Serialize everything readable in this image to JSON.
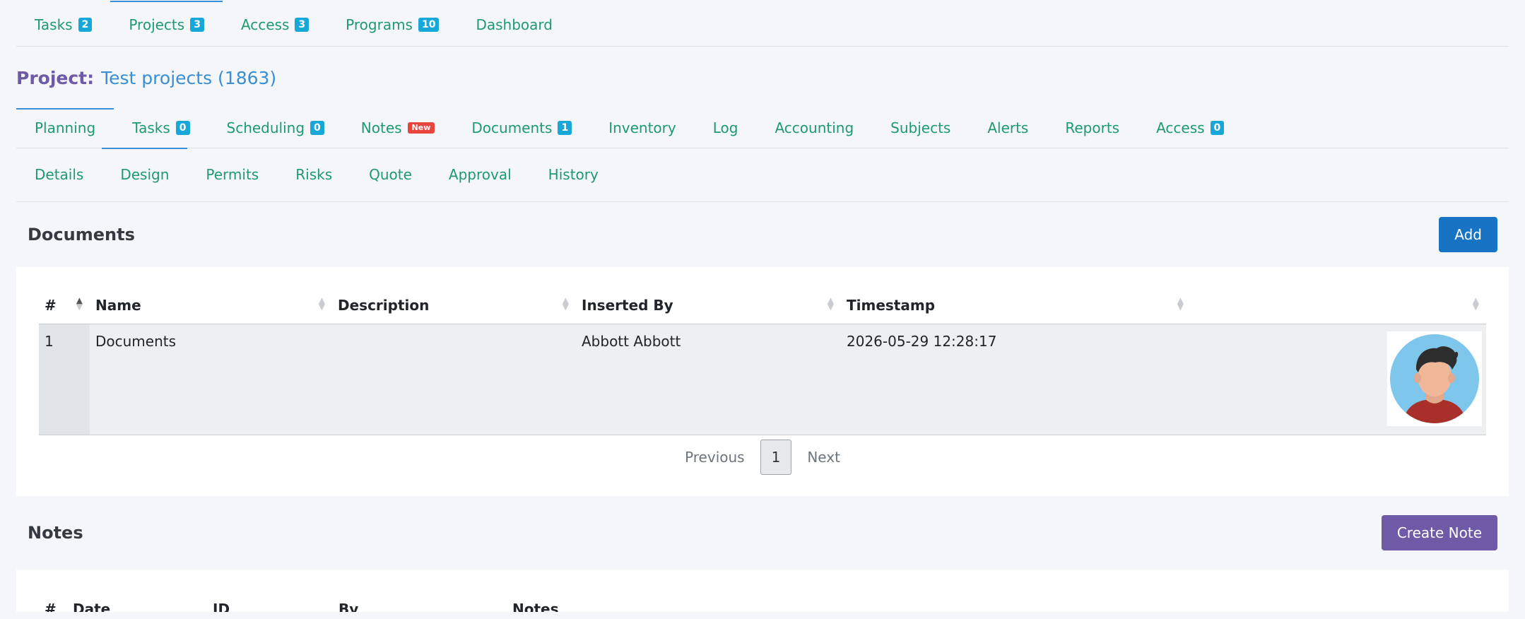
{
  "top_tabs": [
    {
      "label": "Tasks",
      "badge": "2"
    },
    {
      "label": "Projects",
      "badge": "3"
    },
    {
      "label": "Access",
      "badge": "3"
    },
    {
      "label": "Programs",
      "badge": "10"
    },
    {
      "label": "Dashboard"
    }
  ],
  "project": {
    "label": "Project:",
    "value": "Test projects (1863)"
  },
  "project_tabs": [
    {
      "label": "Planning"
    },
    {
      "label": "Tasks",
      "badge": "0"
    },
    {
      "label": "Scheduling",
      "badge": "0"
    },
    {
      "label": "Notes",
      "badge": "New"
    },
    {
      "label": "Documents",
      "badge": "1"
    },
    {
      "label": "Inventory"
    },
    {
      "label": "Log"
    },
    {
      "label": "Accounting"
    },
    {
      "label": "Subjects"
    },
    {
      "label": "Alerts"
    },
    {
      "label": "Reports"
    },
    {
      "label": "Access",
      "badge": "0"
    }
  ],
  "planning_tabs": [
    {
      "label": "Details"
    },
    {
      "label": "Design"
    },
    {
      "label": "Permits"
    },
    {
      "label": "Risks"
    },
    {
      "label": "Quote"
    },
    {
      "label": "Approval"
    },
    {
      "label": "History"
    }
  ],
  "documents": {
    "title": "Documents",
    "add_label": "Add",
    "columns": [
      "#",
      "Name",
      "Description",
      "Inserted By",
      "Timestamp",
      ""
    ],
    "rows": [
      {
        "num": "1",
        "name": "Documents",
        "description": "",
        "inserted_by": "Abbott Abbott",
        "timestamp": "2026-05-29 12:28:17"
      }
    ],
    "pager": {
      "prev": "Previous",
      "current": "1",
      "next": "Next"
    }
  },
  "notes": {
    "title": "Notes",
    "create_label": "Create Note",
    "columns": [
      "#",
      "Date",
      "ID",
      "By",
      "Notes",
      "",
      ""
    ]
  },
  "colors": {
    "tab_text": "#1e9a6e",
    "badge": "#17a7d9",
    "active_border": "#3a8ed1",
    "add_button": "#1774c5",
    "note_button": "#6f5aa7"
  },
  "icons": {
    "avatar": "user-avatar-icon",
    "sort": "sort-arrows-icon"
  }
}
